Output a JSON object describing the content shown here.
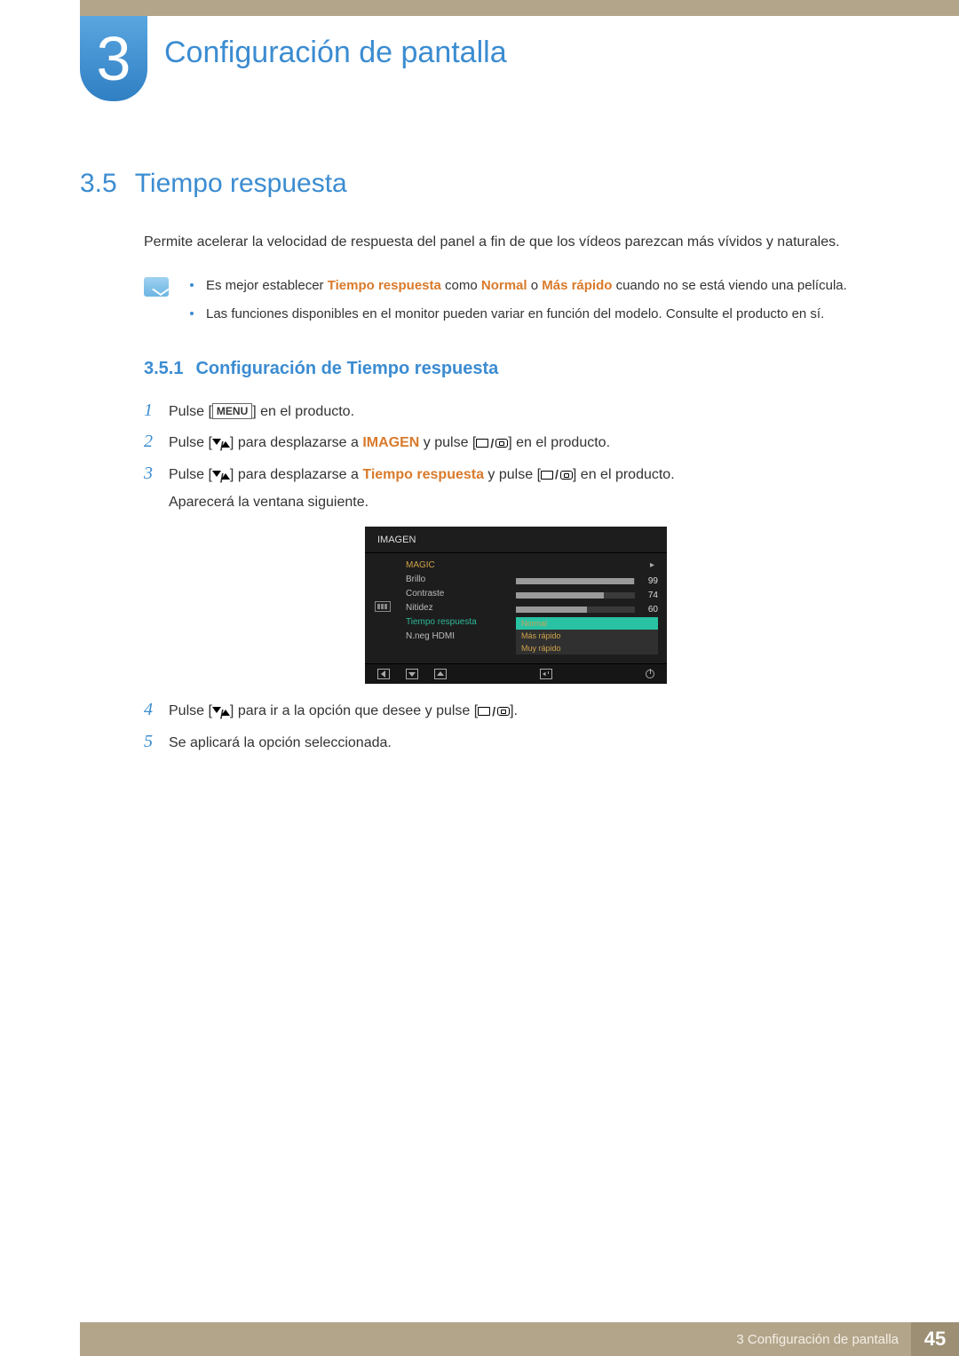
{
  "chapter": {
    "number": "3",
    "title": "Configuración de pantalla"
  },
  "section": {
    "number": "3.5",
    "title": "Tiempo respuesta",
    "intro": "Permite acelerar la velocidad de respuesta del panel a fin de que los vídeos parezcan más vívidos y naturales."
  },
  "notes": {
    "item1_pre": "Es mejor establecer ",
    "item1_hl1": "Tiempo respuesta",
    "item1_mid1": " como ",
    "item1_hl2": "Normal",
    "item1_mid2": " o ",
    "item1_hl3": "Más rápido",
    "item1_post": " cuando no se está viendo una película.",
    "item2": "Las funciones disponibles en el monitor pueden variar en función del modelo. Consulte el producto en sí."
  },
  "subsection": {
    "number": "3.5.1",
    "title": "Configuración de Tiempo respuesta"
  },
  "steps": {
    "s1_pre": "Pulse [",
    "s1_menu": "MENU",
    "s1_post": "] en el producto.",
    "s2_pre": "Pulse [",
    "s2_mid": "] para desplazarse a ",
    "s2_hl": "IMAGEN",
    "s2_post1": " y pulse [",
    "s2_post2": "] en el producto.",
    "s3_pre": "Pulse [",
    "s3_mid": "] para desplazarse a ",
    "s3_hl": "Tiempo respuesta",
    "s3_post1": " y pulse [",
    "s3_post2": "] en el producto.",
    "s3_extra": "Aparecerá la ventana siguiente.",
    "s4_pre": "Pulse [",
    "s4_mid": "] para ir a la opción que desee y pulse [",
    "s4_post": "].",
    "s5": "Se aplicará la opción seleccionada.",
    "n1": "1",
    "n2": "2",
    "n3": "3",
    "n4": "4",
    "n5": "5"
  },
  "osd": {
    "title": "IMAGEN",
    "magic": "MAGIC",
    "brillo": "Brillo",
    "contraste": "Contraste",
    "nitidez": "Nitidez",
    "tiempo": "Tiempo respuesta",
    "nneg": "N.neg HDMI",
    "vals": {
      "brillo": "99",
      "contraste": "74",
      "nitidez": "60"
    },
    "opts": {
      "normal": "Normal",
      "mas": "Más rápido",
      "muy": "Muy rápido"
    }
  },
  "footer": {
    "label": "3 Configuración de pantalla",
    "page": "45"
  }
}
